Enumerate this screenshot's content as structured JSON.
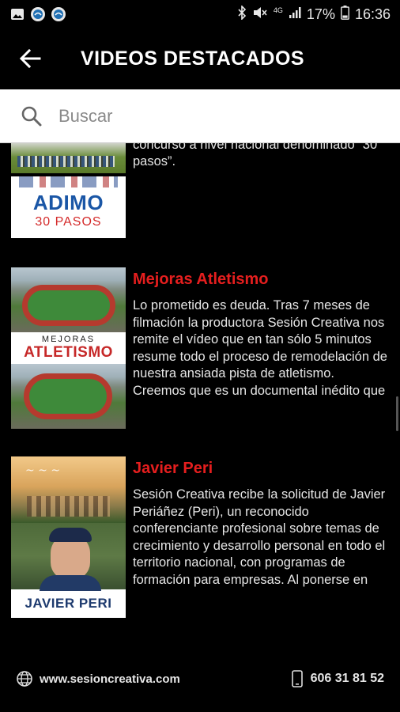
{
  "status_bar": {
    "network_label": "4G",
    "battery": "17%",
    "time": "16:36",
    "icons": [
      "image-icon",
      "app-icon",
      "app-icon",
      "bluetooth-icon",
      "mute-icon",
      "signal-icon",
      "battery-icon"
    ]
  },
  "header": {
    "title": "VIDEOS DESTACADOS"
  },
  "search": {
    "placeholder": "Buscar"
  },
  "videos": [
    {
      "title": "",
      "description": "Diabéticos de Morón con motivo de un concurso a nivel nacional denominado “30 pasos”.",
      "thumb_title": "ADIMO",
      "thumb_subtitle": "30 PASOS"
    },
    {
      "title": "Mejoras Atletismo",
      "description": "Lo prometido es deuda. Tras 7 meses de filmación la productora Sesión Creativa nos remite el vídeo que en tan sólo 5 minutos resume todo el proceso de remodelación de nuestra ansiada pista de atletismo. Creemos que es un documental inédito que quedará para l…",
      "thumb_small": "MEJORAS",
      "thumb_title": "ATLETISMO"
    },
    {
      "title": "Javier Peri",
      "description": "Sesión Creativa recibe la solicitud de Javier Periáñez (Peri), un reconocido conferenciante profesional sobre temas de crecimiento y desarrollo personal en todo el territorio nacional, con programas de formación para empresas. Al ponerse en contacto con nosotros …",
      "thumb_title": "JAVIER PERI"
    }
  ],
  "footer": {
    "website": "www.sesioncreativa.com",
    "phone": "606 31 81 52"
  },
  "colors": {
    "accent_title": "#e51e1e",
    "background": "#000000"
  }
}
